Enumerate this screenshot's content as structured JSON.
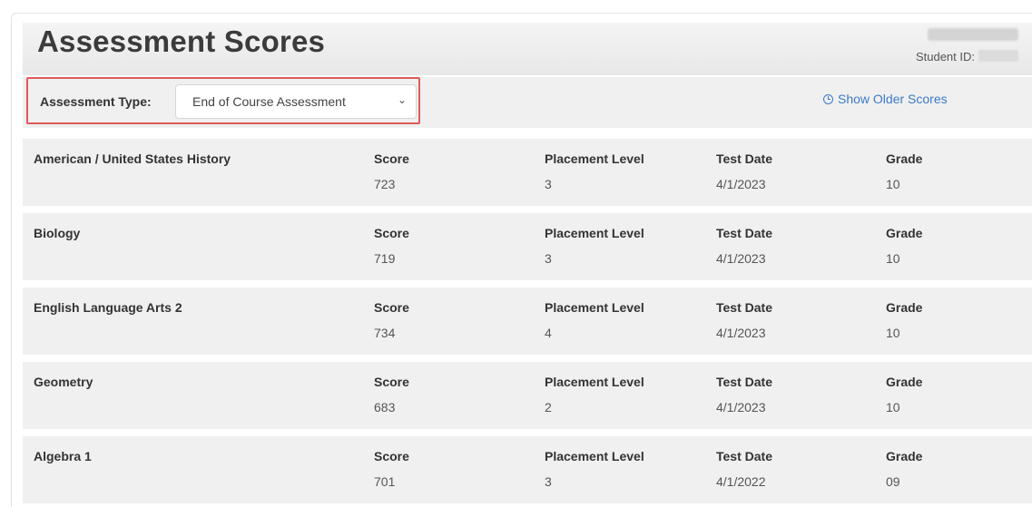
{
  "header": {
    "title": "Assessment Scores",
    "student_id_label": "Student ID:"
  },
  "filter": {
    "label": "Assessment Type:",
    "selected": "End of Course Assessment",
    "show_older": "Show Older Scores"
  },
  "labels": {
    "score": "Score",
    "placement": "Placement Level",
    "test_date": "Test Date",
    "grade": "Grade"
  },
  "rows": [
    {
      "subject": "American / United States History",
      "score": "723",
      "placement": "3",
      "date": "4/1/2023",
      "grade": "10"
    },
    {
      "subject": "Biology",
      "score": "719",
      "placement": "3",
      "date": "4/1/2023",
      "grade": "10"
    },
    {
      "subject": "English Language Arts 2",
      "score": "734",
      "placement": "4",
      "date": "4/1/2023",
      "grade": "10"
    },
    {
      "subject": "Geometry",
      "score": "683",
      "placement": "2",
      "date": "4/1/2023",
      "grade": "10"
    },
    {
      "subject": "Algebra 1",
      "score": "701",
      "placement": "3",
      "date": "4/1/2022",
      "grade": "09"
    }
  ],
  "colors": {
    "highlight": "#e05a5a",
    "link": "#3a7bc8"
  }
}
